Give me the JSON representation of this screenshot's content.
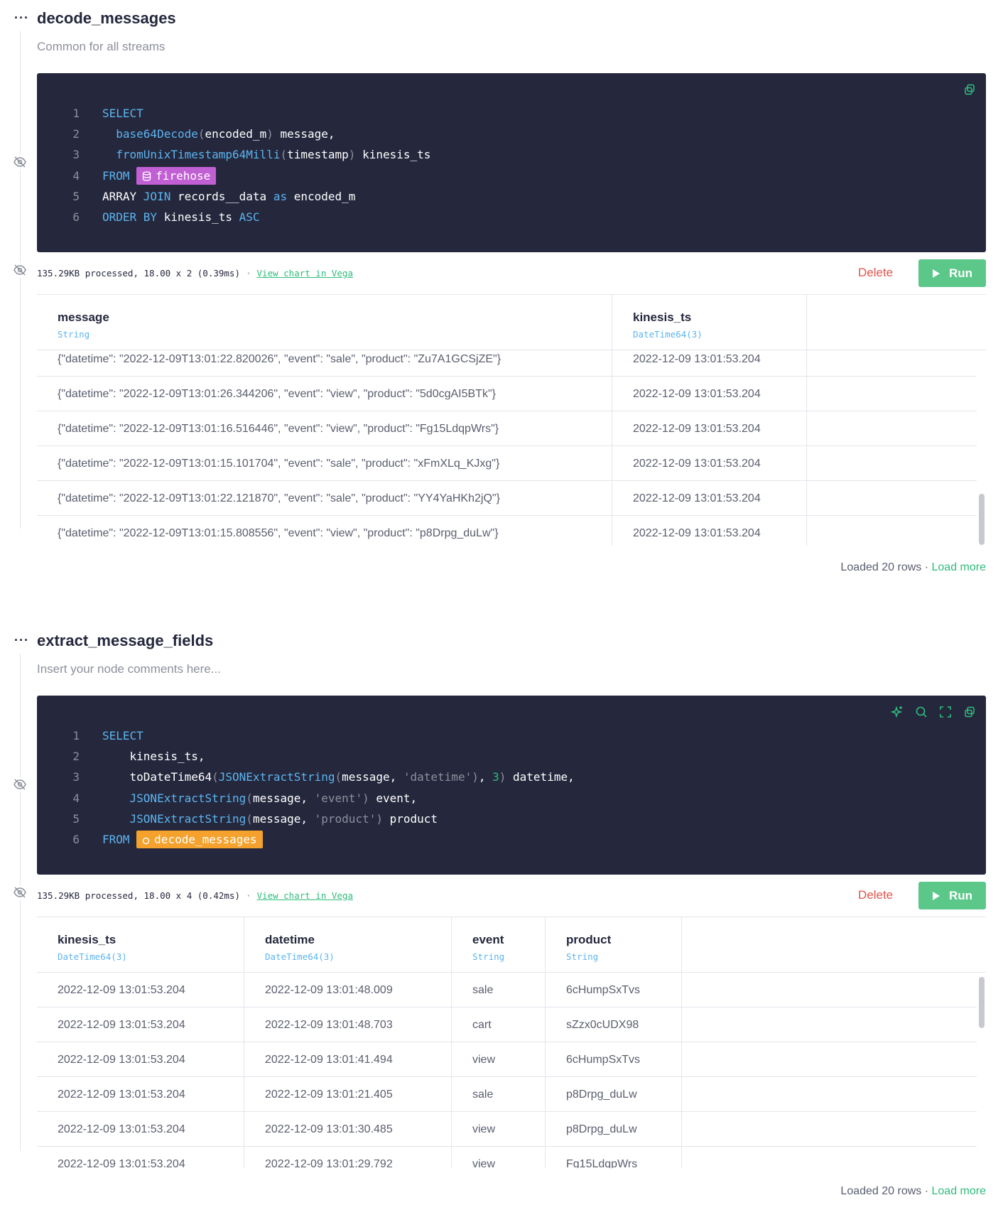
{
  "nodes": [
    {
      "title": "decode_messages",
      "description": "Common for all streams",
      "code": [
        {
          "n": "1"
        },
        {
          "n": "2"
        },
        {
          "n": "3"
        },
        {
          "n": "4"
        },
        {
          "n": "5"
        },
        {
          "n": "6"
        }
      ],
      "code_tokens": {
        "l1": [
          "SELECT"
        ],
        "l2": [
          "base64Decode",
          "(",
          "encoded_m",
          ")",
          " message,"
        ],
        "l3": [
          "fromUnixTimestamp64Milli",
          "(",
          "timestamp",
          ")",
          " kinesis_ts"
        ],
        "l4": [
          "FROM",
          "firehose"
        ],
        "l5": [
          "ARRAY ",
          "JOIN",
          " records__data ",
          "as",
          " encoded_m"
        ],
        "l6": [
          "ORDER BY",
          " kinesis_ts ",
          "ASC"
        ]
      },
      "stats": "135.29KB processed, 18.00 x 2 (0.39ms)",
      "stats_sep": "·",
      "vega_link": "View chart in Vega",
      "delete_label": "Delete",
      "run_label": "Run",
      "columns": [
        {
          "name": "message",
          "type": "String"
        },
        {
          "name": "kinesis_ts",
          "type": "DateTime64(3)"
        }
      ],
      "rows": [
        [
          "{\"datetime\": \"2022-12-09T13:01:22.820026\", \"event\": \"sale\", \"product\": \"Zu7A1GCSjZE\"}",
          "2022-12-09 13:01:53.204"
        ],
        [
          "{\"datetime\": \"2022-12-09T13:01:26.344206\", \"event\": \"view\", \"product\": \"5d0cgAI5BTk\"}",
          "2022-12-09 13:01:53.204"
        ],
        [
          "{\"datetime\": \"2022-12-09T13:01:16.516446\", \"event\": \"view\", \"product\": \"Fg15LdqpWrs\"}",
          "2022-12-09 13:01:53.204"
        ],
        [
          "{\"datetime\": \"2022-12-09T13:01:15.101704\", \"event\": \"sale\", \"product\": \"xFmXLq_KJxg\"}",
          "2022-12-09 13:01:53.204"
        ],
        [
          "{\"datetime\": \"2022-12-09T13:01:22.121870\", \"event\": \"sale\", \"product\": \"YY4YaHKh2jQ\"}",
          "2022-12-09 13:01:53.204"
        ],
        [
          "{\"datetime\": \"2022-12-09T13:01:15.808556\", \"event\": \"view\", \"product\": \"p8Drpg_duLw\"}",
          "2022-12-09 13:01:53.204"
        ]
      ],
      "loaded": "Loaded 20 rows · ",
      "load_more": "Load more"
    },
    {
      "title": "extract_message_fields",
      "description": "Insert your node comments here...",
      "code_tokens": {
        "l1": [
          "SELECT"
        ],
        "l2": [
          "kinesis_ts,"
        ],
        "l3": [
          "toDateTime64",
          "(",
          "JSONExtractString",
          "(",
          "message, ",
          "'datetime'",
          ")",
          ", ",
          "3",
          ")",
          " datetime,"
        ],
        "l4": [
          "JSONExtractString",
          "(",
          "message, ",
          "'event'",
          ")",
          " event,"
        ],
        "l5": [
          "JSONExtractString",
          "(",
          "message, ",
          "'product'",
          ")",
          " product"
        ],
        "l6": [
          "FROM",
          "decode_messages"
        ]
      },
      "stats": "135.29KB processed, 18.00 x 4 (0.42ms)",
      "stats_sep": "·",
      "vega_link": "View chart in Vega",
      "delete_label": "Delete",
      "run_label": "Run",
      "columns": [
        {
          "name": "kinesis_ts",
          "type": "DateTime64(3)"
        },
        {
          "name": "datetime",
          "type": "DateTime64(3)"
        },
        {
          "name": "event",
          "type": "String"
        },
        {
          "name": "product",
          "type": "String"
        }
      ],
      "rows": [
        [
          "2022-12-09 13:01:53.204",
          "2022-12-09 13:01:48.009",
          "sale",
          "6cHumpSxTvs"
        ],
        [
          "2022-12-09 13:01:53.204",
          "2022-12-09 13:01:48.703",
          "cart",
          "sZzx0cUDX98"
        ],
        [
          "2022-12-09 13:01:53.204",
          "2022-12-09 13:01:41.494",
          "view",
          "6cHumpSxTvs"
        ],
        [
          "2022-12-09 13:01:53.204",
          "2022-12-09 13:01:21.405",
          "sale",
          "p8Drpg_duLw"
        ],
        [
          "2022-12-09 13:01:53.204",
          "2022-12-09 13:01:30.485",
          "view",
          "p8Drpg_duLw"
        ],
        [
          "2022-12-09 13:01:53.204",
          "2022-12-09 13:01:29.792",
          "view",
          "Fg15LdqpWrs"
        ]
      ],
      "loaded": "Loaded 20 rows · ",
      "load_more": "Load more"
    }
  ],
  "colors": {
    "editor_bg": "#25283d",
    "keyword": "#5cb4ef",
    "datasource_tag": "#c15fd4",
    "node_tag": "#f4a22d",
    "run_button": "#5bc88a",
    "delete": "#e2524a",
    "link": "#2ebd7a"
  },
  "icons": [
    "more-dots-icon",
    "eye-off-icon",
    "copy-icon",
    "sparkle-icon",
    "search-icon",
    "expand-icon",
    "play-icon",
    "database-icon",
    "node-circle-icon"
  ]
}
